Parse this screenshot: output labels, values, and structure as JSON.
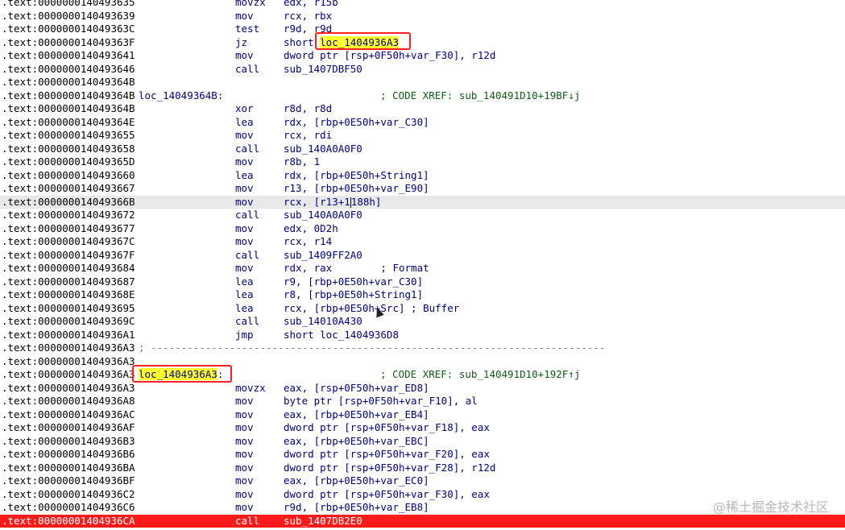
{
  "lines": [
    {
      "addr": ".text:0000000140493635",
      "mn": "movzx",
      "ops": "edx, r15b"
    },
    {
      "addr": ".text:0000000140493639",
      "mn": "mov",
      "ops": "rcx, rbx"
    },
    {
      "addr": ".text:000000014049363C",
      "mn": "test",
      "ops": "r9d, r9d"
    },
    {
      "addr": ".text:000000014049363F",
      "mn": "jz",
      "ops": "short ",
      "ops_hl": "loc_1404936A3"
    },
    {
      "addr": ".text:0000000140493641",
      "mn": "mov",
      "ops": "dword ptr [rsp+0F50h+var_F30], r12d"
    },
    {
      "addr": ".text:0000000140493646",
      "mn": "call",
      "ops": "sub_1407DBF50"
    },
    {
      "addr": ".text:000000014049364B"
    },
    {
      "addr": ".text:000000014049364B",
      "label": "loc_14049364B:",
      "cmt": "; CODE XREF: sub_140491D10+19BF↓j"
    },
    {
      "addr": ".text:000000014049364B",
      "mn": "xor",
      "ops": "r8d, r8d"
    },
    {
      "addr": ".text:000000014049364E",
      "mn": "lea",
      "ops": "rdx, [rbp+0E50h+var_C30]"
    },
    {
      "addr": ".text:0000000140493655",
      "mn": "mov",
      "ops": "rcx, rdi"
    },
    {
      "addr": ".text:0000000140493658",
      "mn": "call",
      "ops": "sub_140A0A0F0"
    },
    {
      "addr": ".text:000000014049365D",
      "mn": "mov",
      "ops": "r8b, 1"
    },
    {
      "addr": ".text:0000000140493660",
      "mn": "lea",
      "ops": "rdx, [rbp+0E50h+String1]"
    },
    {
      "addr": ".text:0000000140493667",
      "mn": "mov",
      "ops": "r13, [rbp+0E50h+var_E90]"
    },
    {
      "addr": ".text:000000014049366B",
      "mn": "mov",
      "ops": "rcx, [r13+1",
      "ops_after_cursor": "188h]",
      "current": true
    },
    {
      "addr": ".text:0000000140493672",
      "mn": "call",
      "ops": "sub_140A0A0F0"
    },
    {
      "addr": ".text:0000000140493677",
      "mn": "mov",
      "ops": "edx, 0D2h"
    },
    {
      "addr": ".text:000000014049367C",
      "mn": "mov",
      "ops": "rcx, r14"
    },
    {
      "addr": ".text:000000014049367F",
      "mn": "call",
      "ops": "sub_1409FF2A0"
    },
    {
      "addr": ".text:0000000140493684",
      "mn": "mov",
      "ops": "rdx, rax        ; Format"
    },
    {
      "addr": ".text:0000000140493687",
      "mn": "lea",
      "ops": "r9, [rbp+0E50h+var_C30]"
    },
    {
      "addr": ".text:000000014049368E",
      "mn": "lea",
      "ops": "r8, [rbp+0E50h+String1]"
    },
    {
      "addr": ".text:0000000140493695",
      "mn": "lea",
      "ops": "rcx, [rbp+0E50h+Src] ; Buffer"
    },
    {
      "addr": ".text:000000014049369C",
      "mn": "call",
      "ops": "sub_14010A430"
    },
    {
      "addr": ".text:00000001404936A1",
      "mn": "jmp",
      "ops": "short loc_1404936D8"
    },
    {
      "addr": ".text:00000001404936A3",
      "sep": "; ---------------------------------------------------------------------------"
    },
    {
      "addr": ".text:00000001404936A3"
    },
    {
      "addr": ".text:00000001404936A3",
      "label_hl": "loc_1404936A3",
      "label_suffix": ":",
      "cmt": "; CODE XREF: sub_140491D10+192F↑j"
    },
    {
      "addr": ".text:00000001404936A3",
      "mn": "movzx",
      "ops": "eax, [rsp+0F50h+var_ED8]"
    },
    {
      "addr": ".text:00000001404936A8",
      "mn": "mov",
      "ops": "byte ptr [rsp+0F50h+var_F10], al"
    },
    {
      "addr": ".text:00000001404936AC",
      "mn": "mov",
      "ops": "eax, [rbp+0E50h+var_EB4]"
    },
    {
      "addr": ".text:00000001404936AF",
      "mn": "mov",
      "ops": "dword ptr [rsp+0F50h+var_F18], eax"
    },
    {
      "addr": ".text:00000001404936B3",
      "mn": "mov",
      "ops": "eax, [rbp+0E50h+var_EBC]"
    },
    {
      "addr": ".text:00000001404936B6",
      "mn": "mov",
      "ops": "dword ptr [rsp+0F50h+var_F20], eax"
    },
    {
      "addr": ".text:00000001404936BA",
      "mn": "mov",
      "ops": "dword ptr [rsp+0F50h+var_F28], r12d"
    },
    {
      "addr": ".text:00000001404936BF",
      "mn": "mov",
      "ops": "eax, [rbp+0E50h+var_EC0]"
    },
    {
      "addr": ".text:00000001404936C2",
      "mn": "mov",
      "ops": "dword ptr [rsp+0F50h+var_F30], eax"
    },
    {
      "addr": ".text:00000001404936C6",
      "mn": "mov",
      "ops": "r9d, [rbp+0E50h+var_EB8]"
    },
    {
      "addr": ".text:00000001404936CA",
      "mn": "call",
      "ops": "sub_1407DB2E0",
      "breakpoint": true
    }
  ],
  "watermark": "@稀土掘金技术社区",
  "colors": {
    "highlight": "#ffff30",
    "annotation_box": "#ff2020",
    "breakpoint": "#ff1a1a",
    "comment": "#0f5e14",
    "instruction": "#000080"
  }
}
